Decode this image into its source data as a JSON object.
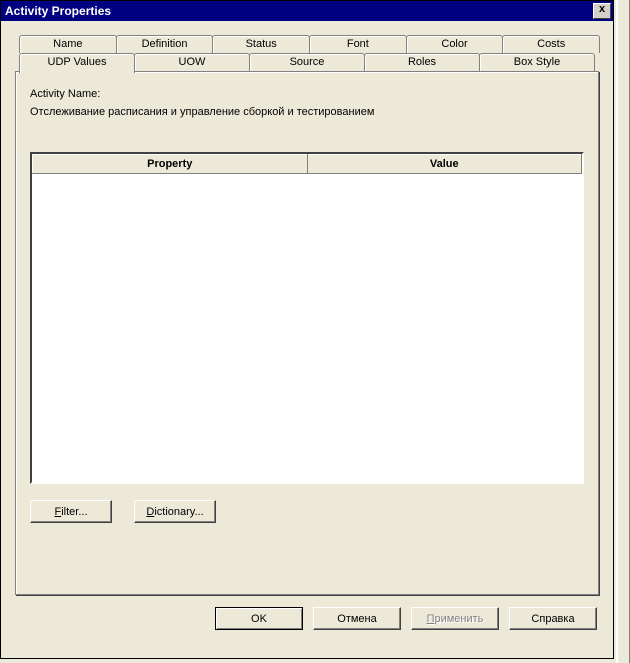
{
  "window": {
    "title": "Activity Properties"
  },
  "tabs": {
    "back": [
      "Name",
      "Definition",
      "Status",
      "Font",
      "Color",
      "Costs"
    ],
    "front": [
      "UDP Values",
      "UOW",
      "Source",
      "Roles",
      "Box Style"
    ],
    "active": "UDP Values"
  },
  "panel": {
    "activity_label": "Activity Name:",
    "activity_name": "Отслеживание  расписания и управление  сборкой и тестированием",
    "grid": {
      "columns": [
        "Property",
        "Value"
      ],
      "rows": []
    },
    "filter_btn": "Filter...",
    "dictionary_btn": "Dictionary..."
  },
  "buttons": {
    "ok": "OK",
    "cancel": "Отмена",
    "apply": "Применить",
    "help": "Справка"
  }
}
